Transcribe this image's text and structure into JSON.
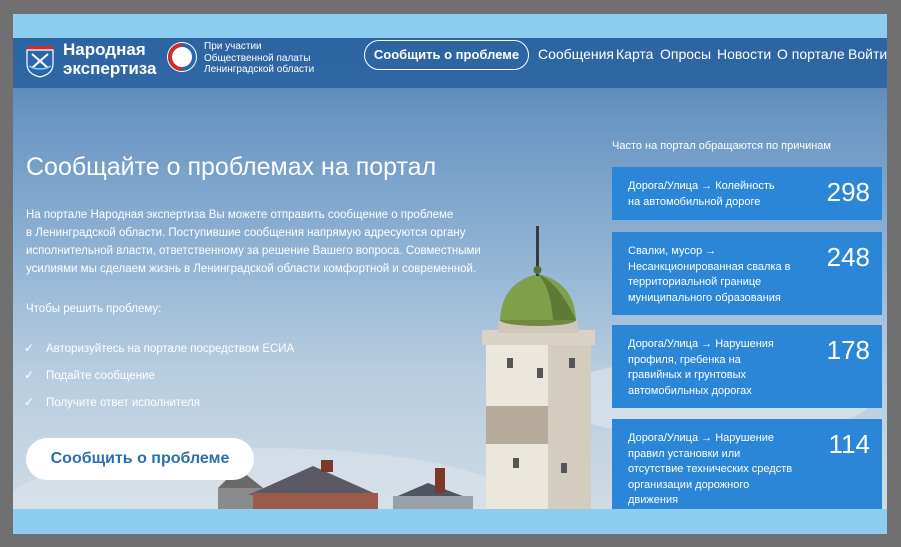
{
  "header": {
    "logo_line1": "Народная",
    "logo_line2": "экспертиза",
    "partner_line1": "При участии",
    "partner_line2": "Общественной палаты",
    "partner_line3": "Ленинградской области",
    "report_button": "Сообщить о проблеме",
    "nav": [
      "Сообщения",
      "Карта",
      "Опросы",
      "Новости",
      "О портале",
      "Войти"
    ]
  },
  "hero": {
    "title": "Сообщайте о проблемах на портал",
    "text_lines": [
      "На портале Народная экспертиза Вы можете отправить сообщение о проблеме",
      "в Ленинградской области. Поступившие сообщения напрямую адресуются органу",
      "исполнительной власти, ответственному за решение Вашего вопроса. Совместными",
      "усилиями мы сделаем жизнь в Ленинградской области комфортной и современной."
    ],
    "steps_title": "Чтобы решить проблему:",
    "steps": [
      "Авторизуйтесь на портале посредством ЕСИА",
      "Подайте сообщение",
      "Получите ответ исполнителя"
    ],
    "button": "Сообщить о проблеме"
  },
  "stats": {
    "title": "Часто на портал обращаются по причинам",
    "items": [
      {
        "lines": [
          "Дорога/Улица  →  Колейность",
          "на автомобильной дороге"
        ],
        "count": "298"
      },
      {
        "lines": [
          "Свалки, мусор  →",
          "Несанкционированная свалка в",
          "территориальной границе",
          "муниципального образования"
        ],
        "count": "248"
      },
      {
        "lines": [
          "Дорога/Улица  →  Нарушения",
          "профиля, гребенка на",
          "гравийных и грунтовых",
          "автомобильных дорогах"
        ],
        "count": "178"
      },
      {
        "lines": [
          "Дорога/Улица  →  Нарушение",
          "правил установки или",
          "отсутствие технических средств",
          "организации дорожного",
          "движения"
        ],
        "count": "114"
      }
    ]
  },
  "icons": {
    "coat": "coat-of-arms-icon",
    "partner": "public-chamber-logo-icon",
    "check": "check-icon"
  },
  "colors": {
    "card": "#2c86d8",
    "header": "#225c9e",
    "button_text": "#2a6fb0"
  }
}
